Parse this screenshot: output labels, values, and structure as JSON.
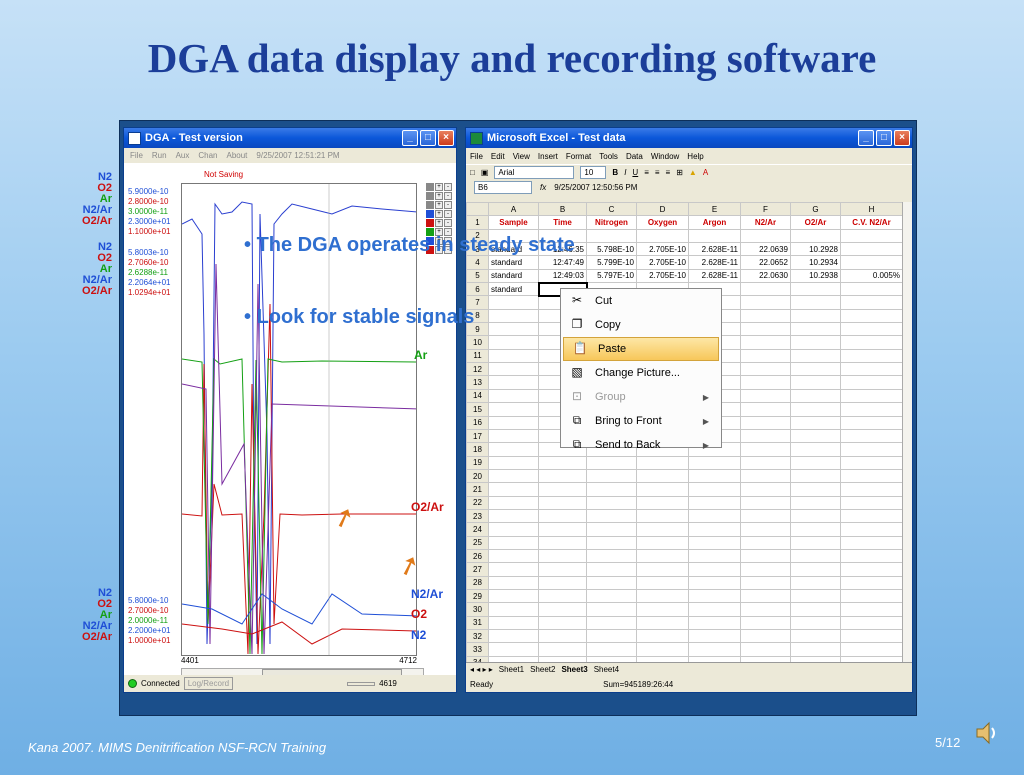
{
  "slide": {
    "title": "DGA data display and recording software",
    "footer": "Kana 2007. MIMS Denitrification NSF-RCN Training",
    "page": "5/12",
    "bullets": [
      "The DGA operates in steady state",
      "Look for stable signals"
    ],
    "annotations": {
      "ar": "Ar",
      "o2ar": "O2/Ar",
      "n2ar": "N2/Ar",
      "o2": "O2",
      "n2": "N2"
    }
  },
  "dga": {
    "title": "DGA -  Test version",
    "menu": [
      "File",
      "Run",
      "Aux",
      "Chan",
      "About",
      "9/25/2007 12:51:21 PM"
    ],
    "not_saving": "Not Saving",
    "legend_names": [
      "N2",
      "O2",
      "Ar",
      "N2/Ar",
      "O2/Ar"
    ],
    "legend_colors": [
      "#1f4fd6",
      "#cc1010",
      "#14a014",
      "#1f4fd6",
      "#cc1010"
    ],
    "top_values": [
      "5.9000e-10",
      "2.8000e-10",
      "3.0000e-11",
      "2.3000e+01",
      "1.1000e+01"
    ],
    "mid_values": [
      "5.8003e-10",
      "2.7060e-10",
      "2.6288e-11",
      "2.2064e+01",
      "1.0294e+01"
    ],
    "bottom_values": [
      "5.8000e-10",
      "2.7000e-10",
      "2.0000e-11",
      "2.2000e+01",
      "1.0000e+01"
    ],
    "x_start": "4401",
    "x_end": "4712",
    "status": {
      "connected": "Connected",
      "log": "Log/Record",
      "count": "4619"
    }
  },
  "excel": {
    "title": "Microsoft Excel - Test data",
    "menu": [
      "File",
      "Edit",
      "View",
      "Insert",
      "Format",
      "Tools",
      "Data",
      "Window",
      "Help"
    ],
    "font": "Arial",
    "font_size": "10",
    "cell_ref": "B6",
    "formula": "9/25/2007  12:50:56 PM",
    "columns": [
      "A",
      "B",
      "C",
      "D",
      "E",
      "F",
      "G",
      "H"
    ],
    "header_row": [
      "Sample",
      "Time",
      "Nitrogen",
      "Oxygen",
      "Argon",
      "N2/Ar",
      "O2/Ar",
      "C.V. N2/Ar"
    ],
    "rows": [
      [
        "",
        "",
        "",
        "",
        "",
        "",
        "",
        ""
      ],
      [
        "standard",
        "12:46:35",
        "5.798E-10",
        "2.705E-10",
        "2.628E-11",
        "22.0639",
        "10.2928",
        ""
      ],
      [
        "standard",
        "12:47:49",
        "5.799E-10",
        "2.705E-10",
        "2.628E-11",
        "22.0652",
        "10.2934",
        ""
      ],
      [
        "standard",
        "12:49:03",
        "5.797E-10",
        "2.705E-10",
        "2.628E-11",
        "22.0630",
        "10.2938",
        "0.005%"
      ],
      [
        "standard",
        "",
        "",
        "",
        "",
        "",
        "",
        ""
      ]
    ],
    "sheets": [
      "Sheet1",
      "Sheet2",
      "Sheet3",
      "Sheet4"
    ],
    "active_sheet": "Sheet3",
    "status": "Ready",
    "sum": "Sum=945189:26:44",
    "context_menu": [
      {
        "label": "Cut",
        "icon": "scissors-icon",
        "enabled": true,
        "submenu": false
      },
      {
        "label": "Copy",
        "icon": "copy-icon",
        "enabled": true,
        "submenu": false
      },
      {
        "label": "Paste",
        "icon": "paste-icon",
        "enabled": true,
        "submenu": false,
        "highlight": true
      },
      {
        "label": "Change Picture...",
        "icon": "picture-icon",
        "enabled": true,
        "submenu": false
      },
      {
        "label": "Group",
        "icon": "group-icon",
        "enabled": false,
        "submenu": true
      },
      {
        "label": "Bring to Front",
        "icon": "bring-front-icon",
        "enabled": true,
        "submenu": true
      },
      {
        "label": "Send to Back",
        "icon": "send-back-icon",
        "enabled": true,
        "submenu": true
      }
    ]
  }
}
